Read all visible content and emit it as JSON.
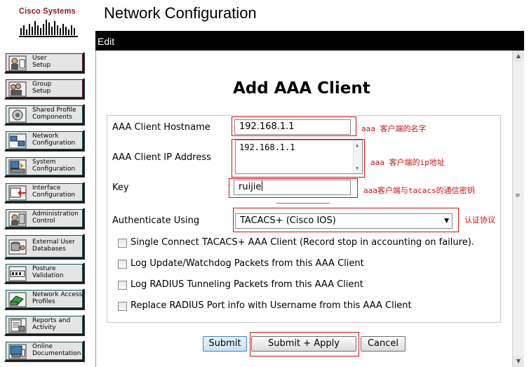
{
  "header": {
    "logo_text": "Cisco Systems",
    "page_title": "Network Configuration"
  },
  "nav": {
    "items": [
      {
        "label": "User\nSetup",
        "icon": "user-setup-icon"
      },
      {
        "label": "Group\nSetup",
        "icon": "group-setup-icon"
      },
      {
        "label": "Shared Profile\nComponents",
        "icon": "shared-profile-icon"
      },
      {
        "label": "Network\nConfiguration",
        "icon": "network-config-icon"
      },
      {
        "label": "System\nConfiguration",
        "icon": "system-config-icon"
      },
      {
        "label": "Interface\nConfiguration",
        "icon": "interface-config-icon"
      },
      {
        "label": "Administration\nControl",
        "icon": "admin-control-icon"
      },
      {
        "label": "External User\nDatabases",
        "icon": "external-db-icon"
      },
      {
        "label": "Posture\nValidation",
        "icon": "posture-icon"
      },
      {
        "label": "Network Access\nProfiles",
        "icon": "nap-icon"
      },
      {
        "label": "Reports and\nActivity",
        "icon": "reports-icon"
      },
      {
        "label": "Online\nDocumentation",
        "icon": "docs-icon"
      }
    ]
  },
  "panel": {
    "edit_label": "Edit",
    "heading": "Add AAA Client"
  },
  "form": {
    "hostname_label": "AAA Client Hostname",
    "hostname_value": "192.168.1.1",
    "ip_label": "AAA Client IP Address",
    "ip_value": "192.168.1.1",
    "key_label": "Key",
    "key_value": "ruijie",
    "auth_label": "Authenticate Using",
    "auth_value": "TACACS+ (Cisco IOS)",
    "checkboxes": [
      "Single Connect TACACS+ AAA Client (Record stop in accounting on failure).",
      "Log Update/Watchdog Packets from this AAA Client",
      "Log RADIUS Tunneling Packets from this AAA Client",
      "Replace RADIUS Port info with Username from this AAA Client"
    ]
  },
  "annotations": {
    "hostname": "aaa 客户端的名字",
    "ip": "aaa 客户端的ip地址",
    "key": "aaa客户端与tacacs的通信密钥",
    "auth": "认证协议"
  },
  "buttons": {
    "submit": "Submit",
    "submit_apply": "Submit + Apply",
    "cancel": "Cancel"
  },
  "colors": {
    "annotation_red": "#d01010",
    "edit_bar": "#000000",
    "brand": "#8b1a1a"
  }
}
